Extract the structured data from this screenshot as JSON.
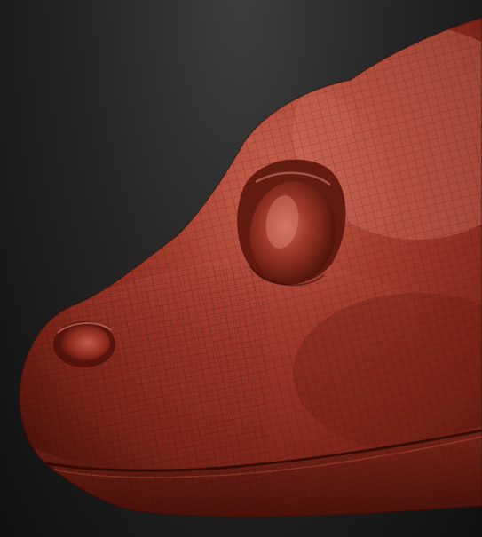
{
  "viewport": {
    "background_top": "#3d3d3d",
    "background_bottom": "#101010"
  },
  "model": {
    "material_base": "#8a2a1e",
    "material_highlight": "#c5604f",
    "material_shadow": "#3e0f09",
    "wireframe_color": "#2d0a06",
    "show_polyframe": true
  }
}
